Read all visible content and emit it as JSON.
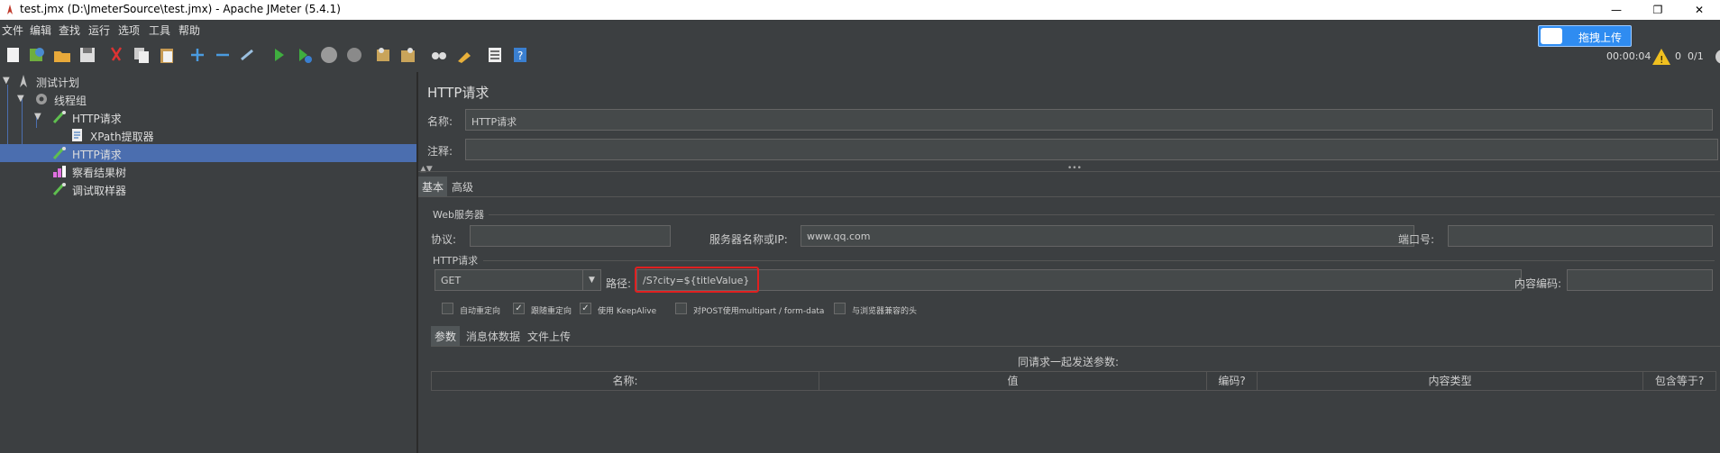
{
  "window": {
    "title": "test.jmx (D:\\JmeterSource\\test.jmx) - Apache JMeter (5.4.1)",
    "minimize": "—",
    "restore": "❐",
    "close": "✕"
  },
  "menu": [
    "文件",
    "编辑",
    "查找",
    "运行",
    "选项",
    "工具",
    "帮助"
  ],
  "toolbar": {
    "icons": [
      "new-icon",
      "templates-icon",
      "open-icon",
      "save-icon",
      "cut-icon",
      "copy-icon",
      "paste-icon",
      "expand-icon",
      "collapse-icon",
      "toggle-icon",
      "start-icon",
      "start-no-pause-icon",
      "stop-icon",
      "shutdown-icon",
      "clear-icon",
      "clear-all-icon",
      "search-icon",
      "reset-search-icon",
      "function-helper-icon",
      "help-icon"
    ],
    "elapsed": "00:00:04",
    "warning_count": "0",
    "threads": "0/1",
    "upload_label": "拖拽上传"
  },
  "tree": {
    "items": [
      {
        "label": "测试计划",
        "icon": "test-plan-icon"
      },
      {
        "label": "线程组",
        "icon": "thread-group-icon"
      },
      {
        "label": "HTTP请求",
        "icon": "sampler-icon"
      },
      {
        "label": "XPath提取器",
        "icon": "extractor-icon"
      },
      {
        "label": "HTTP请求",
        "icon": "sampler-icon"
      },
      {
        "label": "察看结果树",
        "icon": "listener-icon"
      },
      {
        "label": "调试取样器",
        "icon": "sampler-icon"
      }
    ],
    "selected_index": 4
  },
  "panel": {
    "title": "HTTP请求",
    "name_label": "名称:",
    "name_value": "HTTP请求",
    "comment_label": "注释:",
    "comment_value": "",
    "tabs": [
      "基本",
      "高级"
    ],
    "web_server": {
      "title": "Web服务器",
      "protocol_label": "协议:",
      "protocol_value": "",
      "server_label": "服务器名称或IP:",
      "server_value": "www.qq.com",
      "port_label": "端口号:",
      "port_value": ""
    },
    "http_request": {
      "title": "HTTP请求",
      "method": "GET",
      "path_label": "路径:",
      "path_value": "/S?city=${titleValue}",
      "encoding_label": "内容编码:",
      "encoding_value": ""
    },
    "checkboxes": [
      {
        "label": "自动重定向",
        "checked": false
      },
      {
        "label": "跟随重定向",
        "checked": true
      },
      {
        "label": "使用 KeepAlive",
        "checked": true
      },
      {
        "label": "对POST使用multipart / form-data",
        "checked": false
      },
      {
        "label": "与浏览器兼容的头",
        "checked": false
      }
    ],
    "sub_tabs": [
      "参数",
      "消息体数据",
      "文件上传"
    ],
    "params_caption": "同请求一起发送参数:",
    "columns": [
      "名称:",
      "值",
      "编码?",
      "内容类型",
      "包含等于?"
    ]
  }
}
